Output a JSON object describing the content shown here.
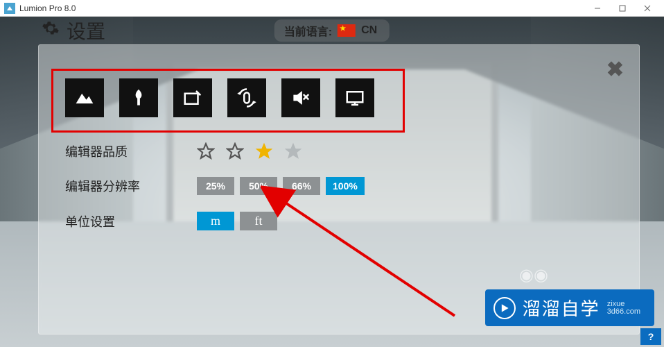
{
  "window": {
    "title": "Lumion Pro 8.0"
  },
  "header": {
    "settings_label": "设置",
    "language_label": "当前语言:",
    "language_code": "CN"
  },
  "toolbar": {
    "icons": [
      {
        "name": "terrain-icon"
      },
      {
        "name": "tree-icon"
      },
      {
        "name": "tablet-edit-icon"
      },
      {
        "name": "mouse-rotate-icon"
      },
      {
        "name": "mute-icon"
      },
      {
        "name": "monitor-icon"
      }
    ]
  },
  "settings": {
    "quality": {
      "label": "编辑器品质",
      "stars_total": 4,
      "stars_filled_index": 2
    },
    "resolution": {
      "label": "编辑器分辨率",
      "options": [
        "25%",
        "50%",
        "66%",
        "100%"
      ],
      "active_index": 3
    },
    "units": {
      "label": "单位设置",
      "options": [
        "m",
        "ft"
      ],
      "active_index": 0
    }
  },
  "annotation": {
    "arrow_target": "resolution-50"
  },
  "watermark": {
    "brand": "溜溜自学",
    "sub1": "zixue",
    "sub2": "3d66.com"
  },
  "help": {
    "label": "?"
  }
}
